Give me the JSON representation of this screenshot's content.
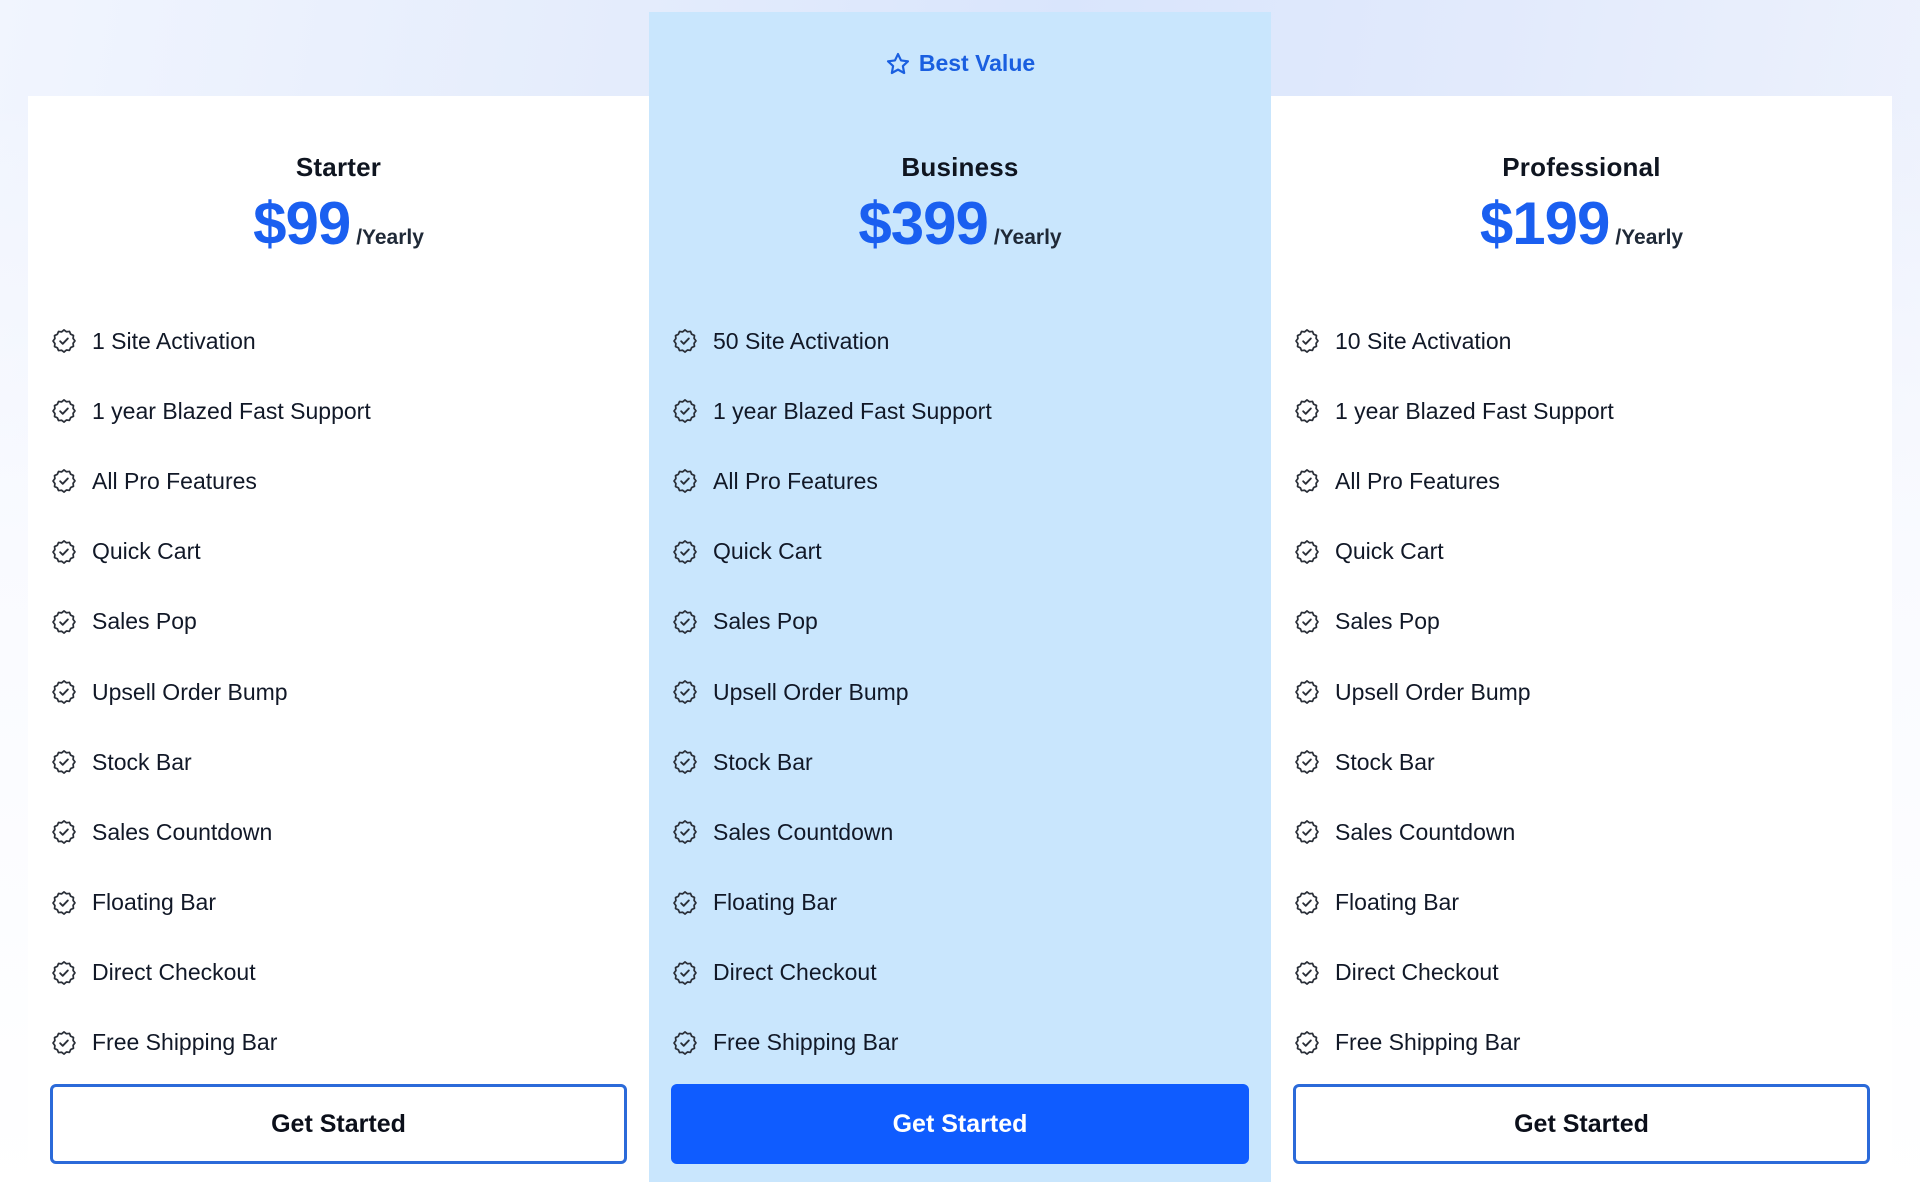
{
  "colors": {
    "accent": "#0f5cff",
    "price": "#1a5ff0",
    "highlight_card_bg": "#c9e6fd",
    "badge_text": "#1a5fe0"
  },
  "badge": {
    "icon": "star-icon",
    "label": "Best Value"
  },
  "plans": [
    {
      "name": "Starter",
      "price": "$99",
      "period": "/Yearly",
      "features": [
        "1 Site Activation",
        "1 year Blazed Fast Support",
        "All Pro Features",
        "Quick Cart",
        "Sales Pop",
        "Upsell Order Bump",
        "Stock Bar",
        "Sales Countdown",
        "Floating Bar",
        "Direct Checkout",
        "Free Shipping Bar"
      ],
      "cta_label": "Get Started",
      "feature_icon": "badge-check-icon"
    },
    {
      "name": "Business",
      "price": "$399",
      "period": "/Yearly",
      "highlighted": true,
      "features": [
        "50 Site Activation",
        "1 year Blazed Fast Support",
        "All Pro Features",
        "Quick Cart",
        "Sales Pop",
        "Upsell Order Bump",
        "Stock Bar",
        "Sales Countdown",
        "Floating Bar",
        "Direct Checkout",
        "Free Shipping Bar"
      ],
      "cta_label": "Get Started",
      "feature_icon": "badge-check-icon"
    },
    {
      "name": "Professional",
      "price": "$199",
      "period": "/Yearly",
      "features": [
        "10 Site Activation",
        "1 year Blazed Fast Support",
        "All Pro Features",
        "Quick Cart",
        "Sales Pop",
        "Upsell Order Bump",
        "Stock Bar",
        "Sales Countdown",
        "Floating Bar",
        "Direct Checkout",
        "Free Shipping Bar"
      ],
      "cta_label": "Get Started",
      "feature_icon": "badge-check-icon"
    }
  ]
}
